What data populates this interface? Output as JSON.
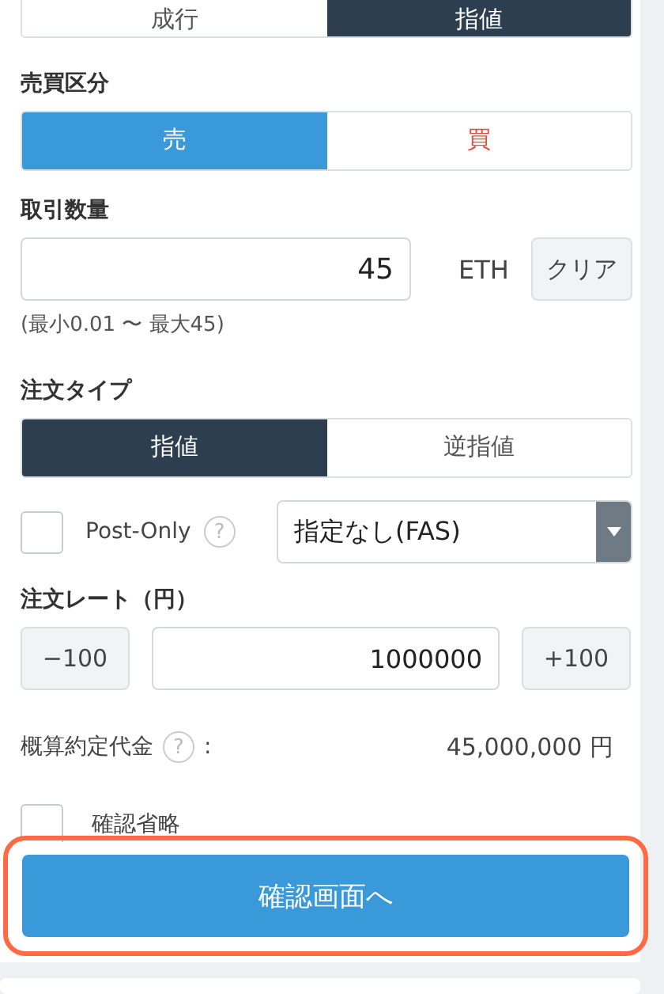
{
  "order_method": [
    {
      "label": "成行",
      "selected": false
    },
    {
      "label": "指値",
      "selected": true
    }
  ],
  "side": {
    "label": "売買区分",
    "options": [
      {
        "label": "売",
        "kind": "sell",
        "selected": true
      },
      {
        "label": "買",
        "kind": "buy",
        "selected": false
      }
    ]
  },
  "quantity": {
    "label": "取引数量",
    "value": "45",
    "unit": "ETH",
    "clear_button": "クリア",
    "hint": "(最小0.01 〜 最大45)"
  },
  "order_type": {
    "label": "注文タイプ",
    "options": [
      {
        "label": "指値",
        "selected": true
      },
      {
        "label": "逆指値",
        "selected": false
      }
    ]
  },
  "post_only": {
    "label": "Post-Only",
    "checked": false,
    "help": "?"
  },
  "execution": {
    "value": "指定なし(FAS)"
  },
  "rate": {
    "label": "注文レート（円）",
    "minus_button": "−100",
    "value": "1000000",
    "plus_button": "+100"
  },
  "estimate": {
    "label": "概算約定代金",
    "help": "?",
    "colon": ":",
    "value": "45,000,000 円"
  },
  "skip_confirm": {
    "label": "確認省略",
    "checked": false
  },
  "confirm_button": {
    "label": "確認画面へ",
    "highlighted": true
  }
}
